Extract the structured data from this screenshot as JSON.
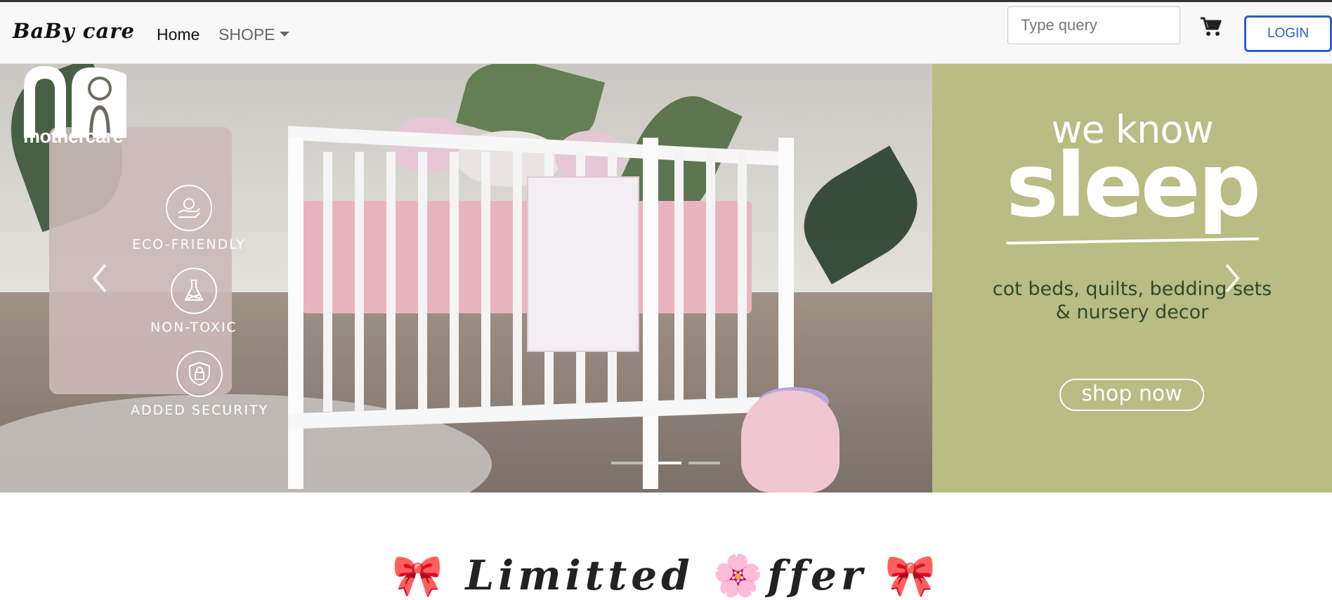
{
  "navbar": {
    "brand": "BaBy care",
    "home_label": "Home",
    "shop_label": "SHOPE",
    "search_placeholder": "Type query",
    "cart_icon": "cart-icon",
    "login_label": "LOGIN"
  },
  "hero": {
    "brand_name": "mothercare",
    "badges": [
      {
        "label": "ECO-FRIENDLY",
        "icon": "eco-hand-icon"
      },
      {
        "label": "NON-TOXIC",
        "icon": "flask-icon"
      },
      {
        "label": "ADDED SECURITY",
        "icon": "lock-shield-icon"
      }
    ],
    "promo": {
      "line1": "we know",
      "headline": "sleep",
      "subtitle_line1": "cot beds, quilts, bedding sets",
      "subtitle_line2": "& nursery decor",
      "cta": "shop now"
    },
    "slides": 3,
    "active_slide": 2
  },
  "offer": {
    "text_before": "Limitted",
    "text_after": "ffer",
    "bow_emoji": "🎀",
    "blossom_emoji": "🌸"
  },
  "colors": {
    "promo_bg": "#b9bc83",
    "login_accent": "#2d5dc8",
    "navbar_bg": "#f8f8f8"
  }
}
